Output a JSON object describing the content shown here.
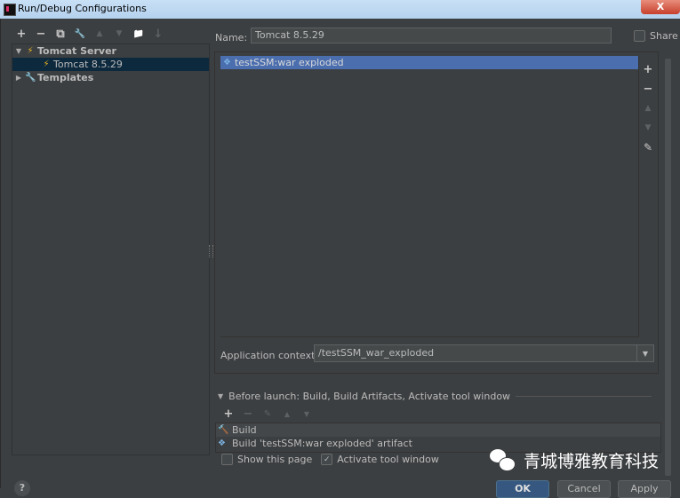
{
  "window": {
    "title": "Run/Debug Configurations",
    "close_label": "X"
  },
  "left_toolbar": [
    {
      "name": "add-config-button",
      "glyph": "+",
      "enabled": true
    },
    {
      "name": "remove-config-button",
      "glyph": "−",
      "enabled": true
    },
    {
      "name": "copy-config-button",
      "glyph": "⧉",
      "enabled": true
    },
    {
      "name": "edit-defaults-button",
      "glyph": "🔧",
      "enabled": true
    },
    {
      "name": "move-up-button",
      "glyph": "▲",
      "enabled": false
    },
    {
      "name": "move-down-button",
      "glyph": "▼",
      "enabled": false
    },
    {
      "name": "new-folder-button",
      "glyph": "📁",
      "enabled": true
    },
    {
      "name": "sort-button",
      "glyph": "↓",
      "enabled": false
    }
  ],
  "tree": {
    "items": [
      {
        "label": "Tomcat Server",
        "level": 0,
        "expanded": true,
        "icon": "tomcat-icon",
        "bold": true,
        "selected": false
      },
      {
        "label": "Tomcat 8.5.29",
        "level": 1,
        "icon": "tomcat-icon",
        "bold": false,
        "selected": true
      },
      {
        "label": "Templates",
        "level": 0,
        "expanded": false,
        "icon": "wrench-icon",
        "bold": true,
        "selected": false
      }
    ]
  },
  "form": {
    "name_label": "Name:",
    "name_value": "Tomcat 8.5.29",
    "share_label": "Share",
    "share_checked": false
  },
  "deployment": {
    "artifacts": [
      "testSSM:war exploded"
    ],
    "side_tools": [
      {
        "name": "add-artifact-button",
        "glyph": "+",
        "enabled": true
      },
      {
        "name": "remove-artifact-button",
        "glyph": "−",
        "enabled": true
      },
      {
        "name": "move-artifact-up-button",
        "glyph": "▲",
        "enabled": false
      },
      {
        "name": "move-artifact-down-button",
        "glyph": "▼",
        "enabled": false
      },
      {
        "name": "edit-artifact-button",
        "glyph": "✎",
        "enabled": true
      }
    ],
    "context_label": "Application context:",
    "context_value": "/testSSM_war_exploded"
  },
  "before_launch": {
    "title": "Before launch: Build, Build Artifacts, Activate tool window",
    "toolbar": [
      {
        "name": "add-task-button",
        "glyph": "+",
        "enabled": true
      },
      {
        "name": "remove-task-button",
        "glyph": "−",
        "enabled": false
      },
      {
        "name": "edit-task-button",
        "glyph": "✎",
        "enabled": false
      },
      {
        "name": "move-task-up-button",
        "glyph": "▲",
        "enabled": false
      },
      {
        "name": "move-task-down-button",
        "glyph": "▼",
        "enabled": false
      }
    ],
    "tasks": [
      {
        "label": "Build",
        "icon": "hammer-icon"
      },
      {
        "label": "Build 'testSSM:war exploded' artifact",
        "icon": "artifact-icon"
      }
    ],
    "show_page_label": "Show this page",
    "show_page_checked": false,
    "activate_label": "Activate tool window",
    "activate_checked": true
  },
  "buttons": {
    "help": "?",
    "ok": "OK",
    "cancel": "Cancel",
    "apply": "Apply"
  },
  "watermark": {
    "text": "青城博雅教育科技"
  },
  "colors": {
    "background": "#3c3f41",
    "selection": "#4b6eaf",
    "tree_selection": "#0d293e",
    "ok_button": "#365880"
  }
}
